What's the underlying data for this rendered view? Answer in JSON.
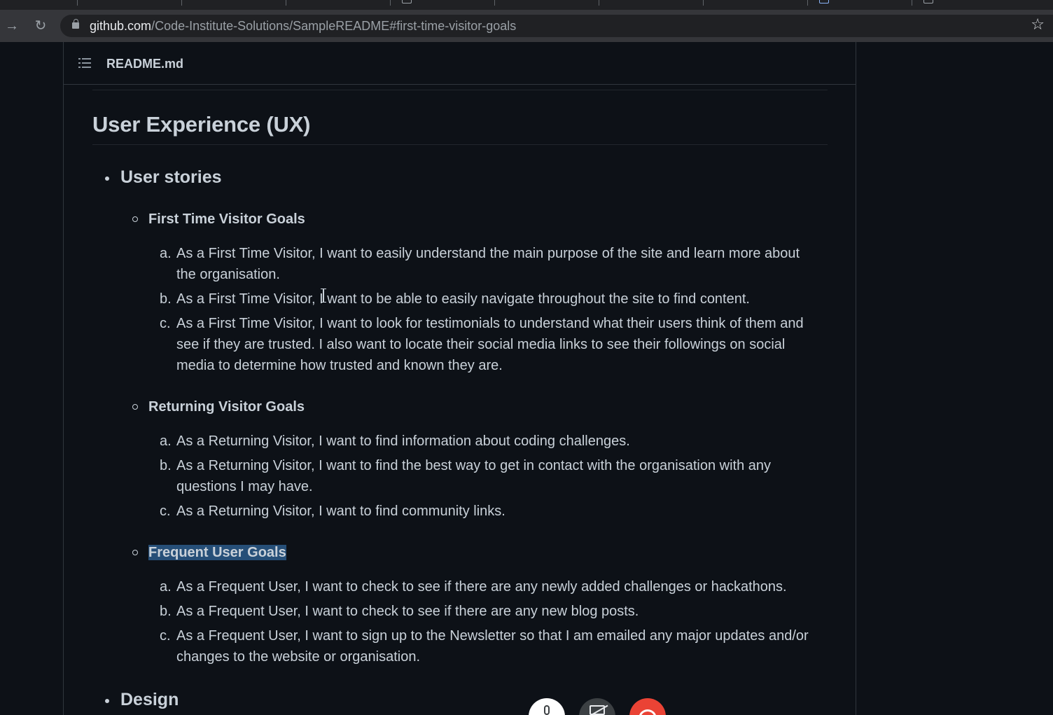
{
  "browser": {
    "url_host": "github.com",
    "url_path": "/Code-Institute-Solutions/SampleREADME#first-time-visitor-goals"
  },
  "readme": {
    "file_name": "README.md",
    "heading": "User Experience (UX)",
    "sections": [
      {
        "title": "User stories",
        "groups": [
          {
            "title": "First Time Visitor Goals",
            "items": [
              {
                "marker": "a.",
                "lines": [
                  "As a First Time Visitor, I want to easily understand the main purpose of the site and learn more about",
                  "the organisation."
                ]
              },
              {
                "marker": "b.",
                "lines": [
                  "As a First Time Visitor, I want to be able to easily navigate throughout the site to find content."
                ]
              },
              {
                "marker": "c.",
                "lines": [
                  "As a First Time Visitor, I want to look for testimonials to understand what their users think of them and",
                  "see if they are trusted. I also want to locate their social media links to see their followings on social",
                  "media to determine how trusted and known they are."
                ]
              }
            ]
          },
          {
            "title": "Returning Visitor Goals",
            "items": [
              {
                "marker": "a.",
                "lines": [
                  "As a Returning Visitor, I want to find information about coding challenges."
                ]
              },
              {
                "marker": "b.",
                "lines": [
                  "As a Returning Visitor, I want to find the best way to get in contact with the organisation with any",
                  "questions I may have."
                ]
              },
              {
                "marker": "c.",
                "lines": [
                  "As a Returning Visitor, I want to find community links."
                ]
              }
            ]
          },
          {
            "title": "Frequent User Goals",
            "highlighted": true,
            "items": [
              {
                "marker": "a.",
                "lines": [
                  "As a Frequent User, I want to check to see if there are any newly added challenges or hackathons."
                ]
              },
              {
                "marker": "b.",
                "lines": [
                  "As a Frequent User, I want to check to see if there are any new blog posts."
                ]
              },
              {
                "marker": "c.",
                "lines": [
                  "As a Frequent User, I want to sign up to the Newsletter so that I am emailed any major updates and/or",
                  "changes to the website or organisation."
                ]
              }
            ]
          }
        ]
      },
      {
        "title": "Design"
      }
    ]
  },
  "call_controls": {
    "icons": [
      "microphone-icon",
      "camera-off-icon",
      "hang-up-icon"
    ],
    "colors": {
      "mic": "#ffffff",
      "camera": "#3c4043",
      "end": "#ea4335"
    }
  },
  "colors": {
    "page_background": "#0d1117",
    "text": "#c9d1d9",
    "border": "#30363d",
    "selection": "#264f78"
  }
}
